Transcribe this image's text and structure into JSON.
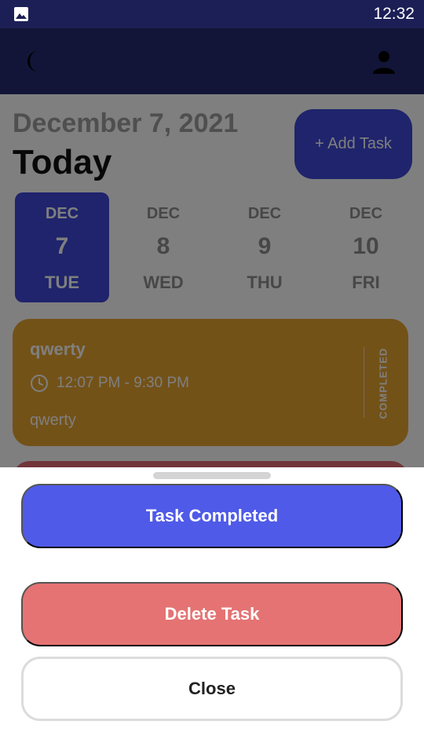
{
  "status_bar": {
    "time": "12:32",
    "image_icon": "image-icon"
  },
  "app_bar": {
    "left_icon": "moon-icon",
    "right_icon": "person-icon"
  },
  "header": {
    "date": "December 7, 2021",
    "title": "Today",
    "add_task_label": "+ Add Task"
  },
  "days": [
    {
      "month": "DEC",
      "day": "7",
      "weekday": "TUE",
      "selected": true
    },
    {
      "month": "DEC",
      "day": "8",
      "weekday": "WED"
    },
    {
      "month": "DEC",
      "day": "9",
      "weekday": "THU"
    },
    {
      "month": "DEC",
      "day": "10",
      "weekday": "FRI"
    }
  ],
  "task": {
    "title": "qwerty",
    "time": "12:07 PM - 9:30 PM",
    "note": "qwerty",
    "status": "COMPLETED",
    "color": "#e7a431"
  },
  "sheet": {
    "completed_label": "Task Completed",
    "delete_label": "Delete Task",
    "close_label": "Close"
  },
  "colors": {
    "primary": "#3f49d8",
    "delete": "#e57373",
    "appbar": "#252a6e"
  }
}
